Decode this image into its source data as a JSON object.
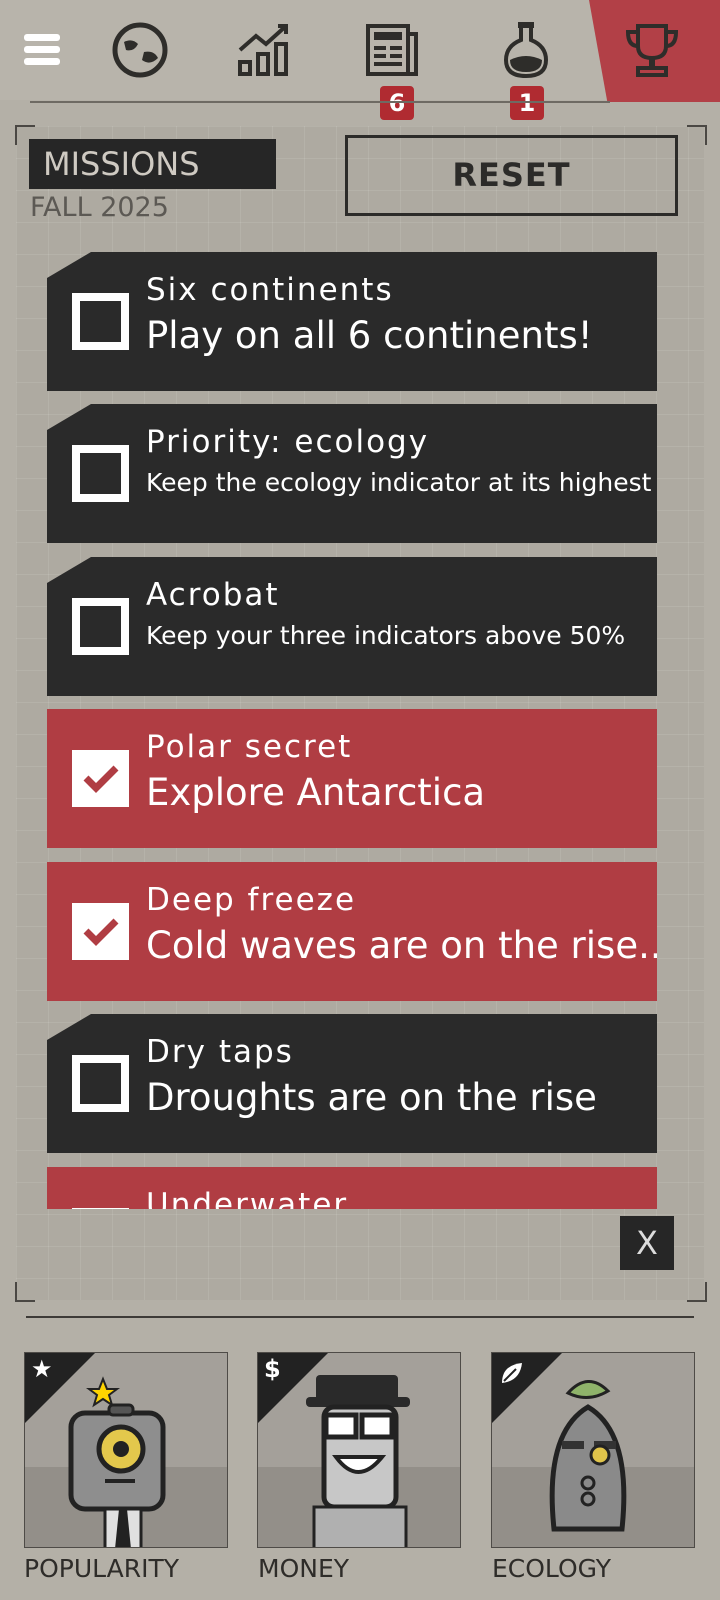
{
  "topbar": {
    "icons": [
      "menu-icon",
      "globe-icon",
      "stats-chart-icon",
      "newspaper-icon",
      "potion-flask-icon",
      "trophy-icon"
    ],
    "badges": {
      "news": "6",
      "lab": "1"
    },
    "accent_color": "#b24047"
  },
  "missions_panel": {
    "title": "MISSIONS",
    "season": "FALL 2025",
    "reset_label": "RESET",
    "close_label": "X",
    "items": [
      {
        "title": "Six continents",
        "description": "Play on all 6 continents!",
        "completed": false
      },
      {
        "title": "Priority: ecology",
        "description": "Keep the ecology indicator at its highest",
        "completed": false
      },
      {
        "title": "Acrobat",
        "description": "Keep your three indicators above 50%",
        "completed": false
      },
      {
        "title": "Polar secret",
        "description": "Explore Antarctica",
        "completed": true
      },
      {
        "title": "Deep freeze",
        "description": "Cold waves are on the rise...",
        "completed": true
      },
      {
        "title": "Dry taps",
        "description": "Droughts are on the rise",
        "completed": false
      },
      {
        "title": "Underwater",
        "description": "",
        "completed": true
      }
    ]
  },
  "advisors": [
    {
      "label": "POPULARITY",
      "icon": "star-icon",
      "glyph": "★"
    },
    {
      "label": "MONEY",
      "icon": "dollar-icon",
      "glyph": "$"
    },
    {
      "label": "ECOLOGY",
      "icon": "leaf-icon",
      "glyph": ""
    }
  ]
}
